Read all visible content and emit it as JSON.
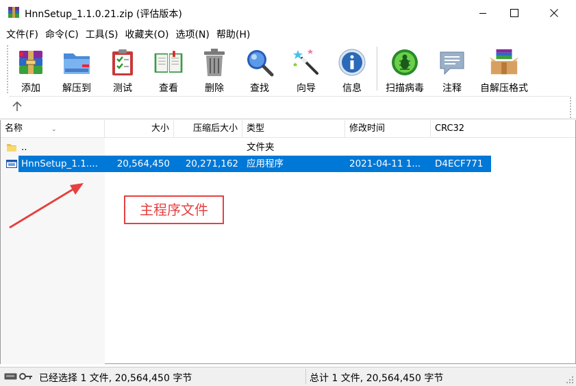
{
  "window": {
    "title": "HnnSetup_1.1.0.21.zip (评估版本)",
    "controls": [
      "minimize-icon",
      "maximize-icon",
      "close-icon"
    ]
  },
  "menu": {
    "items": [
      "文件(F)",
      "命令(C)",
      "工具(S)",
      "收藏夹(O)",
      "选项(N)",
      "帮助(H)"
    ]
  },
  "toolbar": {
    "tools": [
      {
        "label": "添加",
        "icon": "add-archive-icon"
      },
      {
        "label": "解压到",
        "icon": "extract-to-folder-icon"
      },
      {
        "label": "测试",
        "icon": "test-clipboard-icon"
      },
      {
        "label": "查看",
        "icon": "view-book-icon"
      },
      {
        "label": "删除",
        "icon": "delete-trash-icon"
      },
      {
        "label": "查找",
        "icon": "find-magnifier-icon"
      },
      {
        "label": "向导",
        "icon": "wizard-wand-icon"
      },
      {
        "label": "信息",
        "icon": "info-icon"
      },
      {
        "label": "扫描病毒",
        "icon": "virus-scan-icon"
      },
      {
        "label": "注释",
        "icon": "comment-icon"
      },
      {
        "label": "自解压格式",
        "icon": "sfx-box-icon"
      }
    ],
    "up_icon": "up-arrow-icon"
  },
  "filelist": {
    "columns": [
      "名称",
      "大小",
      "压缩后大小",
      "类型",
      "修改时间",
      "CRC32"
    ],
    "rows": [
      {
        "name": "..",
        "size": "",
        "packed": "",
        "type": "文件夹",
        "modified": "",
        "crc": "",
        "icon": "folder-icon"
      },
      {
        "name": "HnnSetup_1.1....",
        "size": "20,564,450",
        "packed": "20,271,162",
        "type": "应用程序",
        "modified": "2021-04-11 1...",
        "crc": "D4ECF771",
        "icon": "application-icon",
        "selected": true
      }
    ]
  },
  "annotation": {
    "text": "主程序文件",
    "color": "#e64040"
  },
  "status": {
    "left": "已经选择 1 文件, 20,564,450 字节",
    "right": "总计 1 文件, 20,564,450 字节"
  },
  "colors": {
    "selection": "#0078d7",
    "annotation": "#e64040"
  }
}
